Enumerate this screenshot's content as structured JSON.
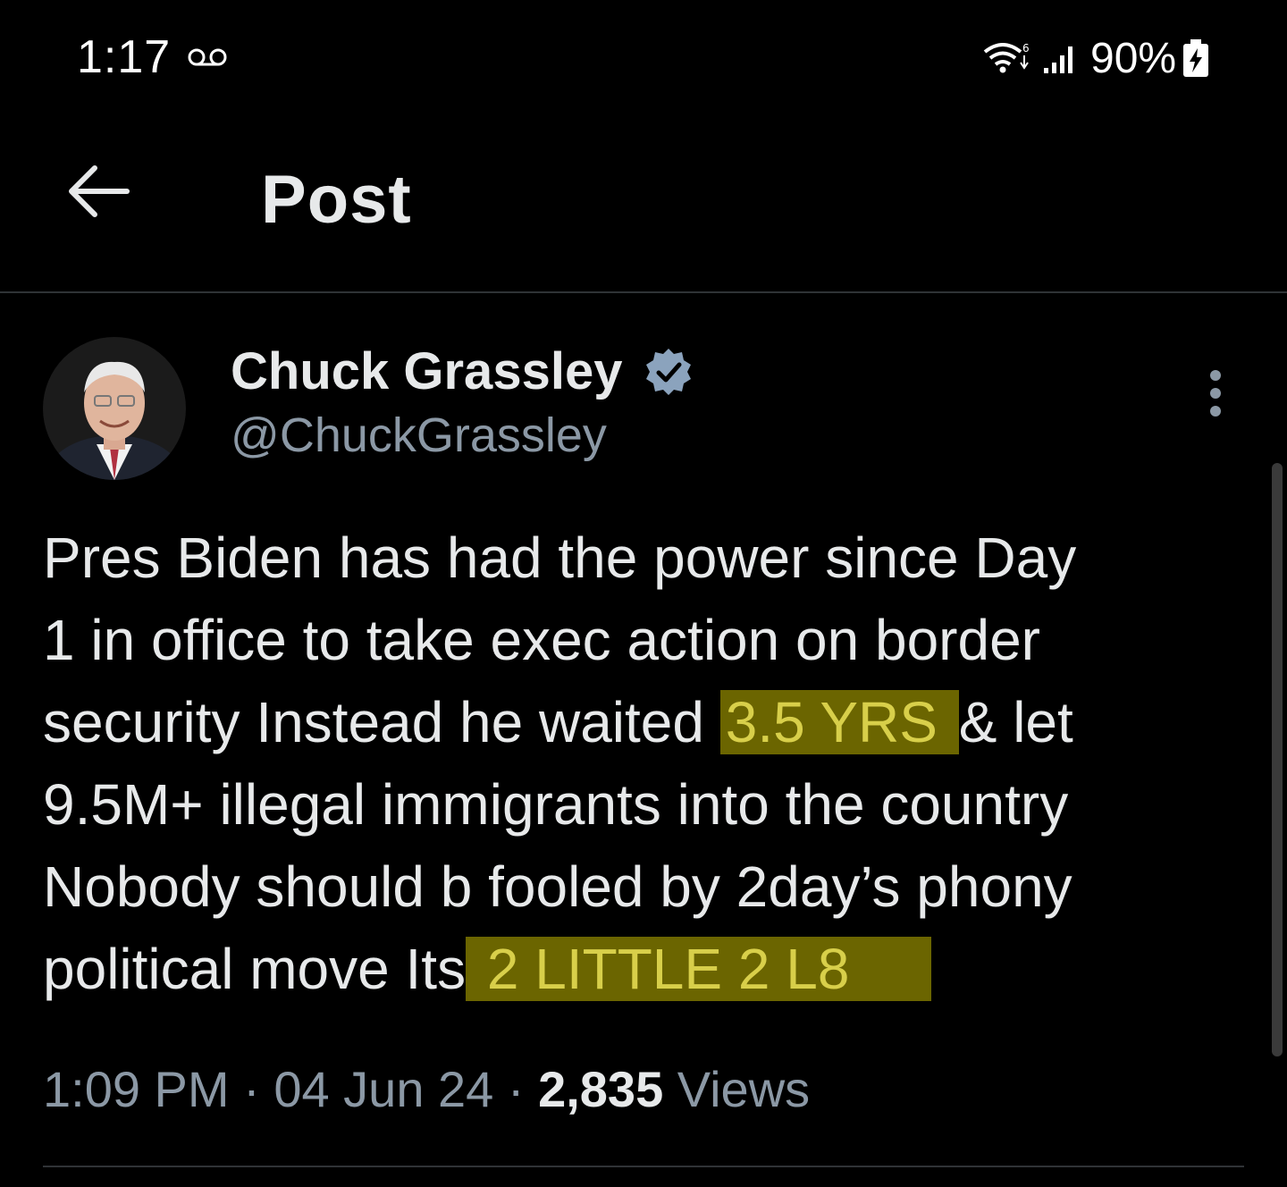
{
  "status_bar": {
    "time": "1:17",
    "battery_percent": "90%",
    "icons": [
      "voicemail-icon",
      "wifi-icon",
      "signal-icon",
      "battery-charging-icon"
    ]
  },
  "header": {
    "title": "Post",
    "back_icon": "arrow-left-icon"
  },
  "post": {
    "author_name": "Chuck Grassley",
    "author_handle": "@ChuckGrassley",
    "verified": true,
    "text_lines": [
      "Pres Biden has had the power since Day",
      "1 in office to take exec action on border",
      "security Instead he waited ",
      "3.5 YRS ",
      "& let",
      "9.5M+ illegal immigrants into the country",
      "Nobody should b fooled by 2day’s phony",
      "political move Its",
      " 2 LITTLE 2 L8"
    ],
    "time": "1:09 PM",
    "separator": " · ",
    "date": "04 Jun 24",
    "views_count": "2,835",
    "views_label": " Views"
  },
  "colors": {
    "background": "#000000",
    "text": "#e7e9ea",
    "secondary_text": "#8b98a5",
    "highlight": "#6b6500",
    "verified_badge": "#8ba3bd"
  }
}
